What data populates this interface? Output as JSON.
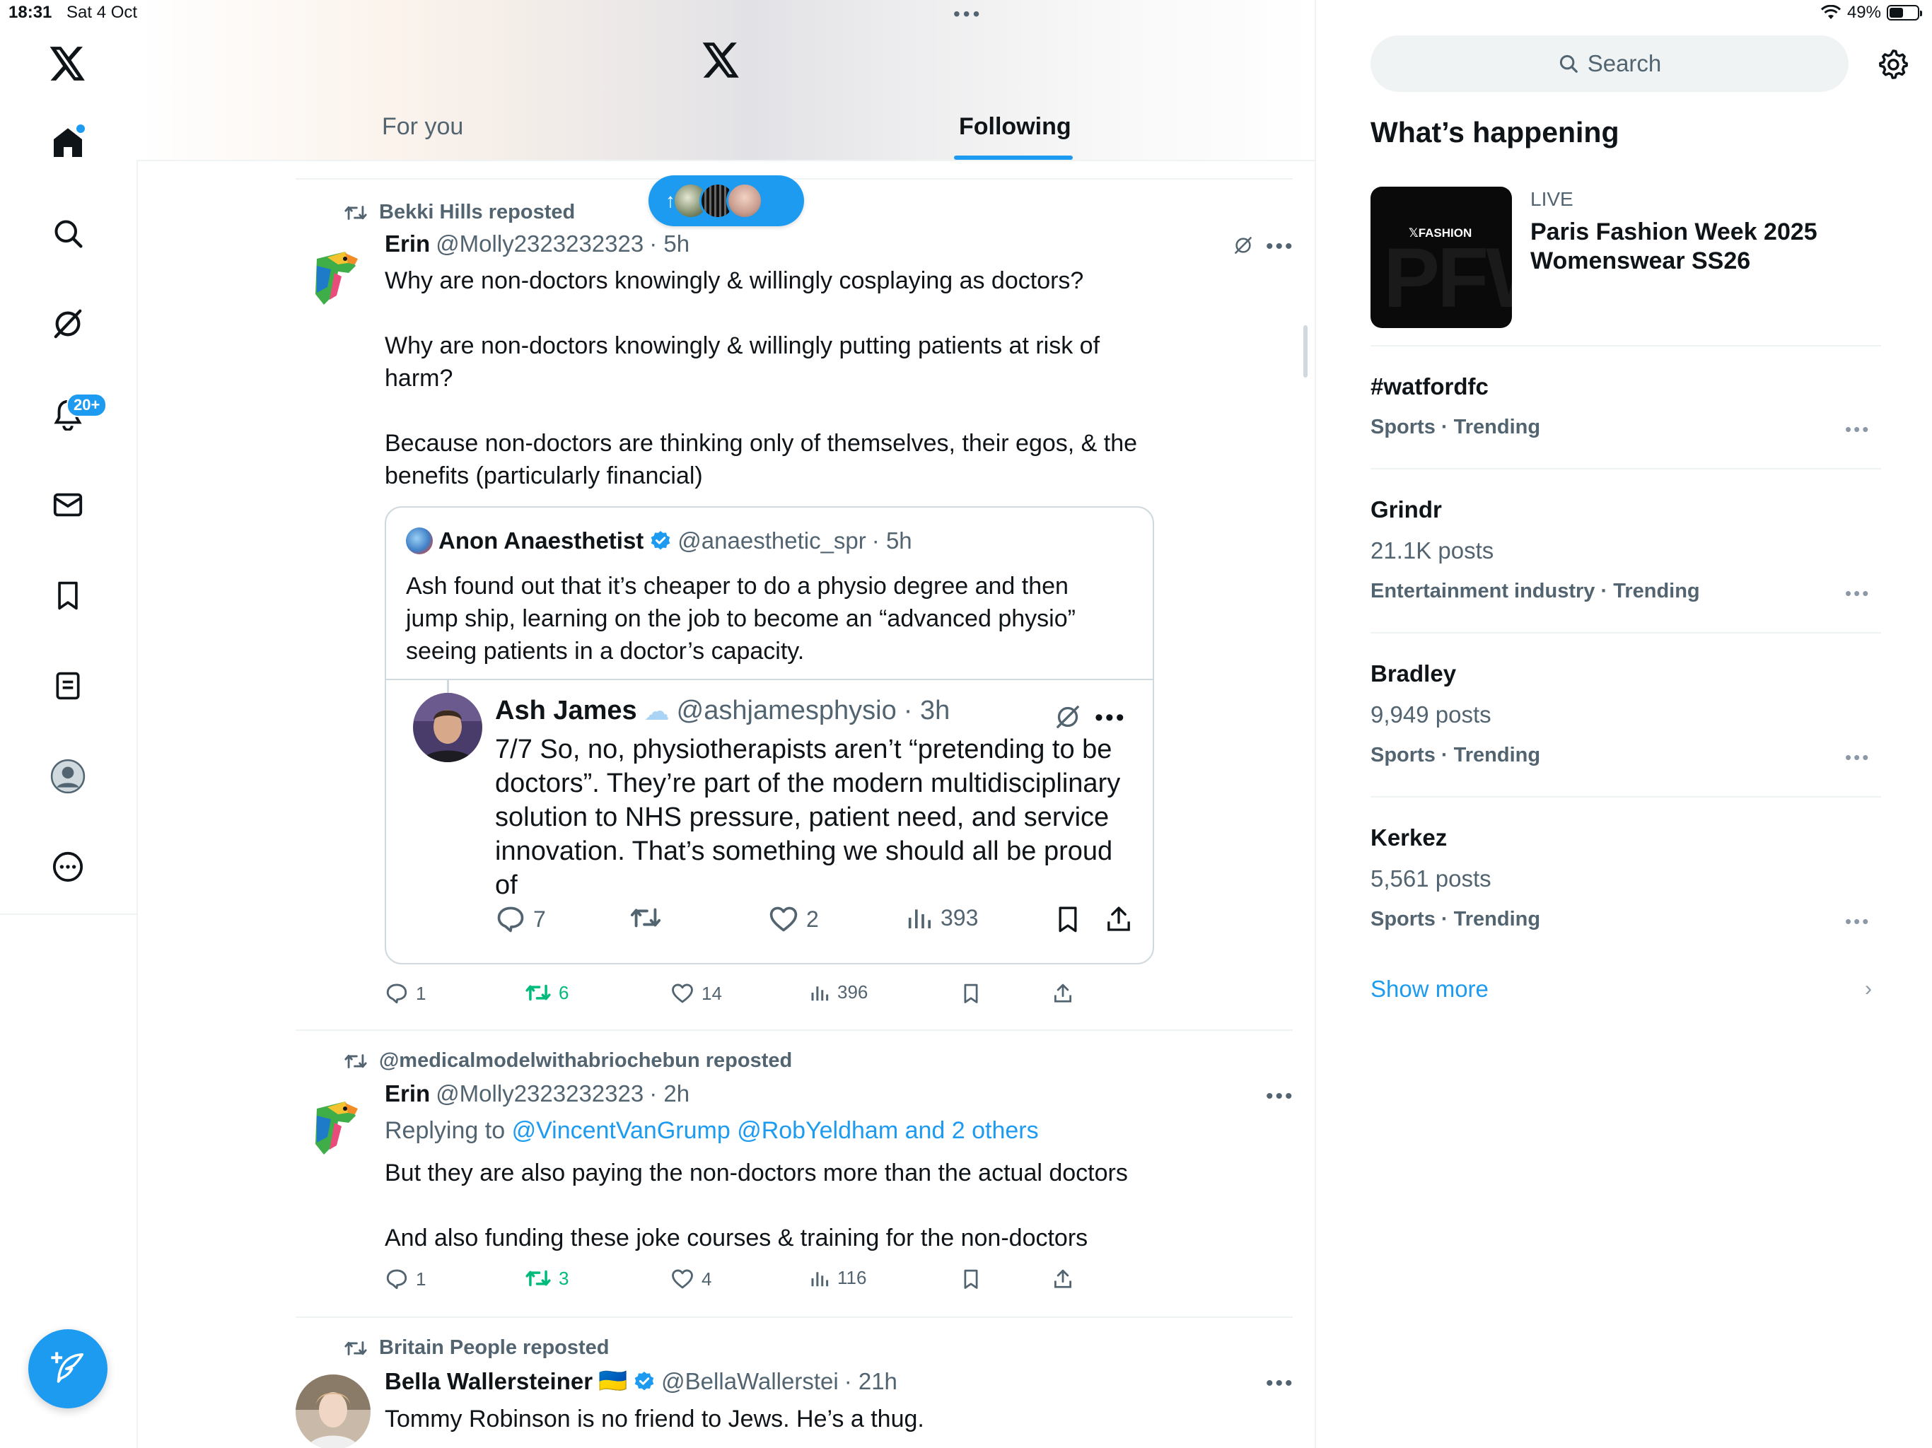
{
  "status_bar": {
    "time": "18:31",
    "date": "Sat 4 Oct",
    "battery": "49%"
  },
  "nav": {
    "logo": "x-logo-icon",
    "items": [
      {
        "name": "home",
        "icon": "home-icon"
      },
      {
        "name": "explore",
        "icon": "search-icon"
      },
      {
        "name": "grok",
        "icon": "grok-icon"
      },
      {
        "name": "notifications",
        "icon": "bell-icon",
        "badge": "20+"
      },
      {
        "name": "messages",
        "icon": "mail-icon"
      },
      {
        "name": "bookmarks",
        "icon": "bookmark-icon"
      },
      {
        "name": "lists",
        "icon": "list-icon"
      },
      {
        "name": "profile",
        "icon": "profile-icon"
      },
      {
        "name": "more",
        "icon": "more-circle-icon"
      }
    ],
    "compose": "compose-icon"
  },
  "tabs": [
    {
      "label": "For you",
      "active": false
    },
    {
      "label": "Following",
      "active": true
    }
  ],
  "posts": [
    {
      "reposted_by": "Bekki Hills reposted",
      "name": "Erin",
      "handle": "@Molly2323232323",
      "time": "· 5h",
      "paragraphs": [
        "Why are non-doctors knowingly & willingly cosplaying as doctors?",
        "Why are non-doctors knowingly & willingly putting patients at risk of harm?",
        "Because non-doctors are thinking only of themselves, their egos, & the benefits (particularly financial)"
      ],
      "quote": {
        "name": "Anon Anaesthetist",
        "handle": "@anaesthetic_spr",
        "time": "· 5h",
        "text": "Ash found out that it’s cheaper to do a physio degree and then jump ship, learning on the job to become an “advanced physio” seeing patients in a doctor’s capacity.",
        "inner": {
          "name": "Ash James",
          "handle": "@ashjamesphysio",
          "time": "· 3h",
          "text": "7/7 So, no,  physiotherapists aren’t “pretending to be doctors”. They’re part of the modern multidisciplinary solution to NHS pressure, patient need, and service innovation. That’s something we should all be proud of",
          "replies": "7",
          "likes": "2",
          "views": "393"
        }
      },
      "replies": "1",
      "reposts": "6",
      "likes": "14",
      "views": "396"
    },
    {
      "reposted_by": "@medicalmodelwithabriochebun reposted",
      "name": "Erin",
      "handle": "@Molly2323232323",
      "time": "· 2h",
      "replying_prefix": "Replying to",
      "replying_to": "@VincentVanGrump @RobYeldham and 2 others",
      "paragraphs": [
        "But they are also paying the non-doctors more than the actual doctors",
        "And also funding these joke courses & training for the non-doctors"
      ],
      "replies": "1",
      "reposts": "3",
      "likes": "4",
      "views": "116"
    },
    {
      "reposted_by": "Britain People reposted",
      "name": "Bella Wallersteiner",
      "flag": "🇺🇦",
      "handle": "@BellaWallerstei",
      "time": "· 21h",
      "paragraphs": [
        "Tommy Robinson is no friend to Jews. He’s a thug."
      ]
    }
  ],
  "sidebar": {
    "search_placeholder": "Search",
    "title": "What’s happening",
    "live": {
      "label": "LIVE",
      "title": "Paris Fashion Week 2025 Womenswear SS26",
      "thumb_label": "FASHION",
      "thumb_bg": "PFW"
    },
    "trends": [
      {
        "title": "#watfordfc",
        "posts": "",
        "meta": "Sports · Trending"
      },
      {
        "title": "Grindr",
        "posts": "21.1K posts",
        "meta": "Entertainment industry · Trending"
      },
      {
        "title": "Bradley",
        "posts": "9,949 posts",
        "meta": "Sports · Trending"
      },
      {
        "title": "Kerkez",
        "posts": "5,561 posts",
        "meta": "Sports · Trending"
      }
    ],
    "show_more": "Show more"
  },
  "colors": {
    "accent": "#1d9bf0",
    "repost_green": "#00ba7c",
    "text": "#0f1419",
    "muted": "#536471"
  }
}
